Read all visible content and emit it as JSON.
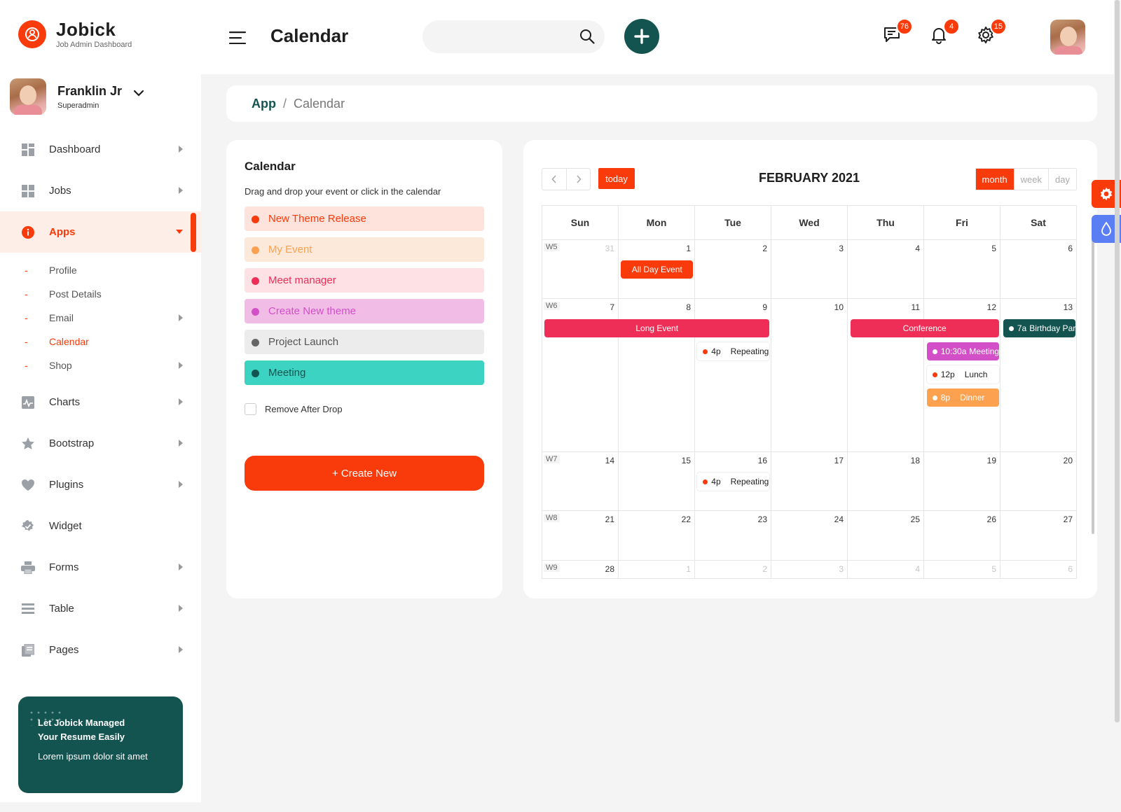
{
  "brand": {
    "title": "Jobick",
    "subtitle": "Job Admin Dashboard",
    "accent": "#f93a0b",
    "dark": "#145450"
  },
  "user": {
    "name": "Franklin Jr",
    "role": "Superadmin"
  },
  "nav": [
    {
      "label": "Dashboard",
      "icon": "dashboard-icon"
    },
    {
      "label": "Jobs",
      "icon": "jobs-icon"
    },
    {
      "label": "Apps",
      "icon": "apps-icon",
      "active": true
    },
    {
      "label": "Charts",
      "icon": "chart-icon"
    },
    {
      "label": "Bootstrap",
      "icon": "star-icon"
    },
    {
      "label": "Plugins",
      "icon": "heart-icon"
    },
    {
      "label": "Widget",
      "icon": "widget-icon"
    },
    {
      "label": "Forms",
      "icon": "printer-icon"
    },
    {
      "label": "Table",
      "icon": "table-icon"
    },
    {
      "label": "Pages",
      "icon": "pages-icon"
    }
  ],
  "apps_sub": [
    {
      "label": "Profile"
    },
    {
      "label": "Post Details"
    },
    {
      "label": "Email",
      "arrow": true
    },
    {
      "label": "Calendar",
      "current": true
    },
    {
      "label": "Shop",
      "arrow": true
    }
  ],
  "promo": {
    "title_1": "Let Jobick Managed",
    "title_2": "Your Resume Easily",
    "text": "Lorem ipsum dolor sit amet"
  },
  "header": {
    "title": "Calendar",
    "search_placeholder": "",
    "badges": {
      "messages": "76",
      "notifications": "4",
      "settings": "15"
    }
  },
  "breadcrumb": {
    "root": "App",
    "separator": "/",
    "current": "Calendar"
  },
  "events_panel": {
    "title": "Calendar",
    "description": "Drag and drop your event or click in the calendar",
    "events": [
      {
        "label": "New Theme Release",
        "bg": "#fde3dc",
        "color": "#f93a0b",
        "dot": "#f93a0b"
      },
      {
        "label": "My Event",
        "bg": "#fde9da",
        "color": "#fba14f",
        "dot": "#fba14f"
      },
      {
        "label": "Meet manager",
        "bg": "#fde1e5",
        "color": "#ee2e57",
        "dot": "#ee2e57"
      },
      {
        "label": "Create New theme",
        "bg": "#f1bde6",
        "color": "#d24fc7",
        "dot": "#d24fc7"
      },
      {
        "label": "Project Launch",
        "bg": "#ececec",
        "color": "#555555",
        "dot": "#666666"
      },
      {
        "label": "Meeting",
        "bg": "#3dd3c3",
        "color": "#145450",
        "dot": "#145450"
      }
    ],
    "remove_after_drop": "Remove After Drop",
    "create_button": "+ Create New"
  },
  "calendar": {
    "month_title": "FEBRUARY 2021",
    "today": "today",
    "views": [
      "month",
      "week",
      "day"
    ],
    "active_view": "month",
    "weekdays": [
      "Sun",
      "Mon",
      "Tue",
      "Wed",
      "Thu",
      "Fri",
      "Sat"
    ],
    "weeks": [
      {
        "label": "W5",
        "days": [
          {
            "n": "31",
            "other": true
          },
          {
            "n": "1"
          },
          {
            "n": "2"
          },
          {
            "n": "3"
          },
          {
            "n": "4"
          },
          {
            "n": "5"
          },
          {
            "n": "6"
          }
        ]
      },
      {
        "label": "W6",
        "days": [
          {
            "n": "7"
          },
          {
            "n": "8"
          },
          {
            "n": "9"
          },
          {
            "n": "10"
          },
          {
            "n": "11"
          },
          {
            "n": "12"
          },
          {
            "n": "13"
          }
        ]
      },
      {
        "label": "W7",
        "days": [
          {
            "n": "14"
          },
          {
            "n": "15"
          },
          {
            "n": "16"
          },
          {
            "n": "17"
          },
          {
            "n": "18"
          },
          {
            "n": "19"
          },
          {
            "n": "20"
          }
        ]
      },
      {
        "label": "W8",
        "days": [
          {
            "n": "21"
          },
          {
            "n": "22"
          },
          {
            "n": "23"
          },
          {
            "n": "24"
          },
          {
            "n": "25"
          },
          {
            "n": "26"
          },
          {
            "n": "27"
          }
        ]
      },
      {
        "label": "W9",
        "days": [
          {
            "n": "28"
          },
          {
            "n": "1",
            "other": true
          },
          {
            "n": "2",
            "other": true
          },
          {
            "n": "3",
            "other": true
          },
          {
            "n": "4",
            "other": true
          },
          {
            "n": "5",
            "other": true
          },
          {
            "n": "6",
            "other": true
          }
        ]
      }
    ],
    "events": {
      "all_day": {
        "label": "All Day Event",
        "color": "#f93a0b"
      },
      "long": {
        "label": "Long Event",
        "color": "#ee2e57"
      },
      "conference": {
        "label": "Conference",
        "color": "#ee2e57"
      },
      "birthday": {
        "time": "7a",
        "label": "Birthday Party",
        "color": "#145450"
      },
      "repeating_1": {
        "time": "4p",
        "label": "Repeating",
        "dot": "#f93a0b"
      },
      "repeating_2": {
        "time": "4p",
        "label": "Repeating",
        "dot": "#f93a0b"
      },
      "meeting": {
        "time": "10:30a",
        "label": "Meeting",
        "color": "#d24fc7"
      },
      "lunch": {
        "time": "12p",
        "label": "Lunch",
        "dot": "#f93a0b"
      },
      "dinner": {
        "time": "8p",
        "label": "Dinner",
        "color": "#fba14f"
      }
    }
  }
}
